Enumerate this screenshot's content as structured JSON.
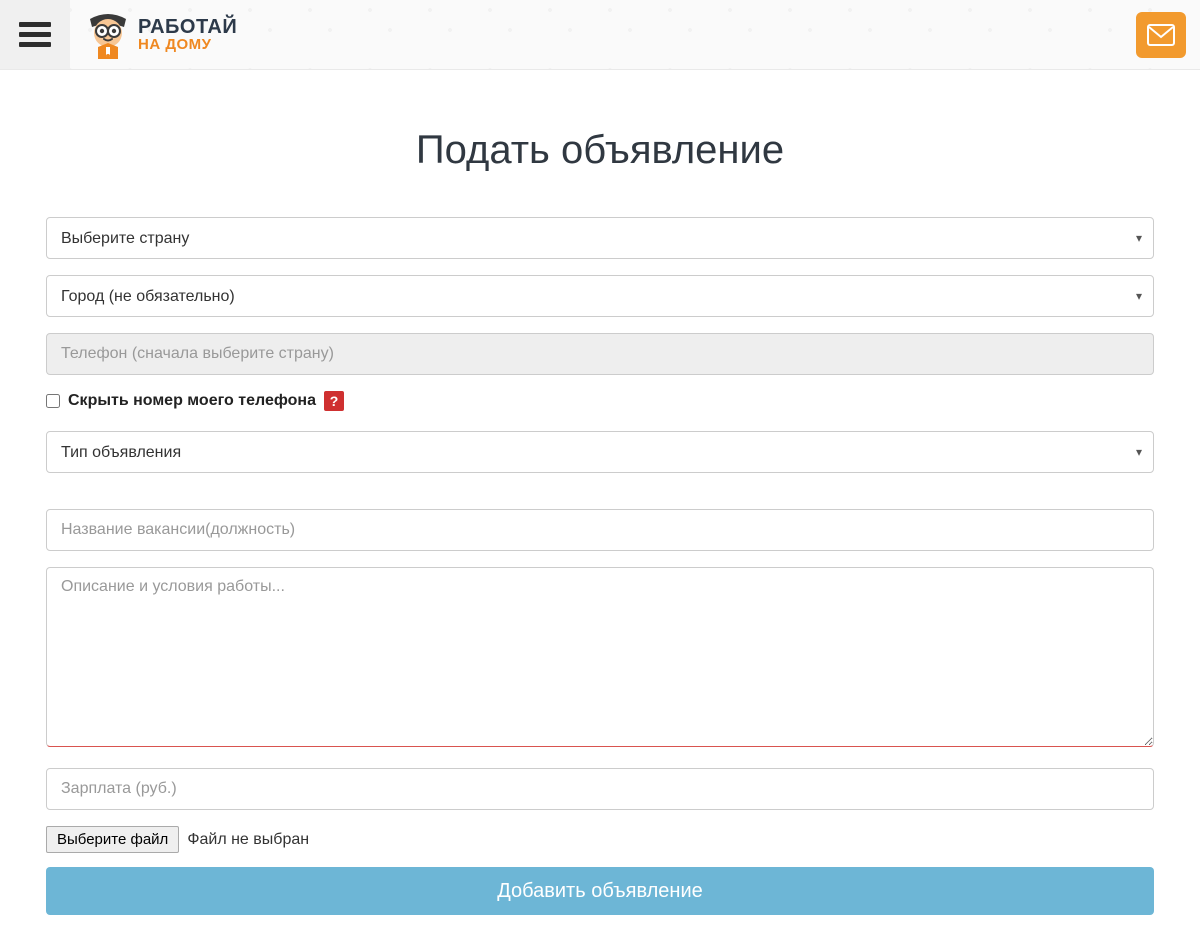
{
  "header": {
    "logo_line1": "РАБОТАЙ",
    "logo_line2": "НА ДОМУ"
  },
  "page": {
    "title": "Подать объявление"
  },
  "form": {
    "country_placeholder": "Выберите страну",
    "city_placeholder": "Город (не обязательно)",
    "phone_placeholder": "Телефон (cначала выберите страну)",
    "hide_phone_label": "Скрыть номер моего телефона",
    "help_badge": "?",
    "ad_type_placeholder": "Тип объявления",
    "title_placeholder": "Название вакансии(должность)",
    "description_placeholder": "Описание и условия работы...",
    "salary_placeholder": "Зарплата (руб.)",
    "file_button": "Выберите файл",
    "file_status": "Файл не выбран",
    "submit_label": "Добавить объявление"
  }
}
